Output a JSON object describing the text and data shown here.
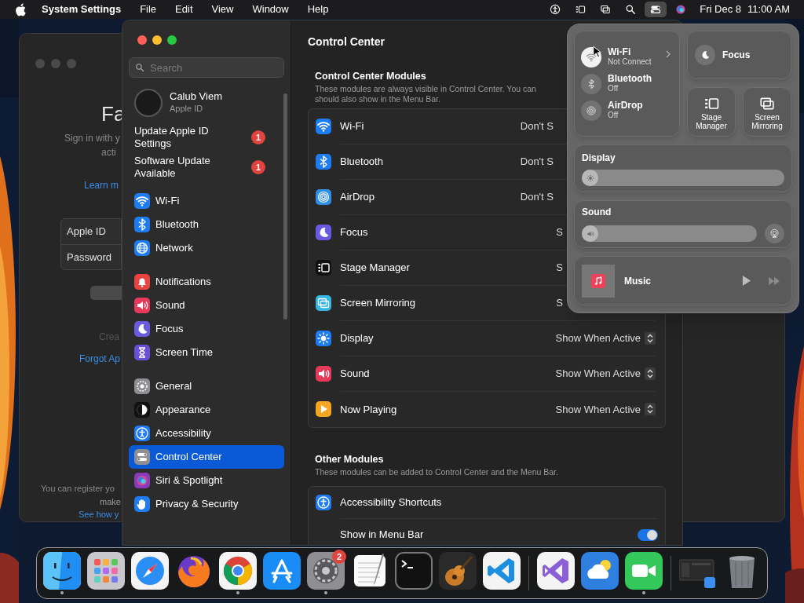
{
  "menu_bar": {
    "app_name": "System Settings",
    "menus": [
      "File",
      "Edit",
      "View",
      "Window",
      "Help"
    ],
    "status_icons": [
      {
        "kind": "accessibility",
        "selected": false
      },
      {
        "kind": "stage",
        "selected": false
      },
      {
        "kind": "mirroring",
        "selected": false
      },
      {
        "kind": "search",
        "selected": false
      },
      {
        "kind": "control",
        "selected": true
      },
      {
        "kind": "siri",
        "selected": false
      }
    ],
    "date": "Fri Dec 8",
    "time": "11:00 AM"
  },
  "background_window": {
    "title": "Fa",
    "subtitle_lines": [
      "Sign in with y",
      "acti"
    ],
    "link": "Learn m",
    "fields": [
      "Apple ID",
      "Password"
    ],
    "create_link": "Crea",
    "forgot_link": "Forgot Ap",
    "footer_lines": [
      "You can register yo",
      "make"
    ],
    "footer_link": "See how y"
  },
  "sidebar": {
    "search": {
      "placeholder": "Search"
    },
    "profile": {
      "name": "Calub Viem",
      "subtitle": "Apple ID"
    },
    "notices": [
      {
        "label": "Update Apple ID Settings",
        "badge": "1"
      },
      {
        "label": "Software Update Available",
        "badge": "1"
      }
    ],
    "groups": [
      [
        {
          "kind": "wifi",
          "color": "#1e7cf2",
          "label": "Wi-Fi",
          "selected": false
        },
        {
          "kind": "bluetooth",
          "color": "#1e7cf2",
          "label": "Bluetooth",
          "selected": false
        },
        {
          "kind": "globe",
          "color": "#1e7cf2",
          "label": "Network",
          "selected": false
        }
      ],
      [
        {
          "kind": "bell",
          "color": "#e9443f",
          "label": "Notifications",
          "selected": false
        },
        {
          "kind": "speaker",
          "color": "#e73a5b",
          "label": "Sound",
          "selected": false
        },
        {
          "kind": "moon",
          "color": "#6a5ae0",
          "label": "Focus",
          "selected": false
        },
        {
          "kind": "hourglass",
          "color": "#6a4fd8",
          "label": "Screen Time",
          "selected": false
        }
      ],
      [
        {
          "kind": "gear",
          "color": "#8e8e93",
          "label": "General",
          "selected": false
        },
        {
          "kind": "appearance",
          "color": "#111111",
          "label": "Appearance",
          "selected": false
        },
        {
          "kind": "person",
          "color": "#1e7cf2",
          "label": "Accessibility",
          "selected": false
        },
        {
          "kind": "toggles",
          "color": "#8e8e93",
          "label": "Control Center",
          "selected": true
        },
        {
          "kind": "orb",
          "color": "#8a3bb8",
          "label": "Siri & Spotlight",
          "selected": false
        },
        {
          "kind": "hand",
          "color": "#1e7cf2",
          "label": "Privacy & Security",
          "selected": false
        }
      ]
    ]
  },
  "content": {
    "title": "Control Center",
    "modules": {
      "title": "Control Center Modules",
      "description_lines": [
        "These modules are always visible in Control Center. You can",
        "should also show in the Menu Bar."
      ],
      "rows": [
        {
          "kind": "wifi",
          "color": "#1e7cf2",
          "label": "Wi-Fi",
          "value": "Don't S",
          "popup": false
        },
        {
          "kind": "bluetooth",
          "color": "#1e7cf2",
          "label": "Bluetooth",
          "value": "Don't S",
          "popup": false
        },
        {
          "kind": "rings",
          "color": "#2f8fe8",
          "label": "AirDrop",
          "value": "Don't S",
          "popup": false
        },
        {
          "kind": "moon",
          "color": "#6a5ae0",
          "label": "Focus",
          "value": "S",
          "popup": false
        },
        {
          "kind": "stage",
          "color": "#111111",
          "label": "Stage Manager",
          "value": "S",
          "popup": false
        },
        {
          "kind": "mirroring",
          "color": "#35b6e0",
          "label": "Screen Mirroring",
          "value": "S",
          "popup": false
        },
        {
          "kind": "sun",
          "color": "#1e7cf2",
          "label": "Display",
          "value": "Show When Active",
          "popup": true
        },
        {
          "kind": "speaker",
          "color": "#e73a5b",
          "label": "Sound",
          "value": "Show When Active",
          "popup": true
        },
        {
          "kind": "play",
          "color": "#f5a623",
          "label": "Now Playing",
          "value": "Show When Active",
          "popup": true
        }
      ]
    },
    "other": {
      "title": "Other Modules",
      "description": "These modules can be added to Control Center and the Menu Bar.",
      "rows": [
        {
          "kind": "accessibility",
          "color": "#1e7cf2",
          "label": "Accessibility Shortcuts"
        },
        {
          "kind": "toggle",
          "label": "Show in Menu Bar",
          "on": true
        }
      ]
    }
  },
  "control_center": {
    "connectivity": [
      {
        "kind": "wifi",
        "label": "Wi-Fi",
        "status": "Not Connect",
        "on": true,
        "expandable": true
      },
      {
        "kind": "bluetooth",
        "label": "Bluetooth",
        "status": "Off",
        "on": false,
        "expandable": false
      },
      {
        "kind": "rings",
        "label": "AirDrop",
        "status": "Off",
        "on": false,
        "expandable": false
      }
    ],
    "focus": {
      "label": "Focus"
    },
    "tiles": [
      {
        "kind": "stage",
        "label": "Stage Manager"
      },
      {
        "kind": "mirroring",
        "label": "Screen Mirroring"
      }
    ],
    "sliders": [
      {
        "kind": "sun",
        "label": "Display",
        "level": 0.04,
        "airplay": false
      },
      {
        "kind": "speaker",
        "label": "Sound",
        "level": 0.04,
        "airplay": true
      }
    ],
    "now_playing": {
      "app": "Music"
    }
  },
  "dock": {
    "sections": [
      [
        {
          "kind": "finder",
          "running": true
        },
        {
          "kind": "launchpad",
          "running": false
        },
        {
          "kind": "safari",
          "running": false
        },
        {
          "kind": "firefox",
          "running": false
        },
        {
          "kind": "chrome",
          "running": true
        },
        {
          "kind": "appstore",
          "running": false
        },
        {
          "kind": "settings",
          "running": true,
          "badge": "2"
        },
        {
          "kind": "textedit",
          "running": false
        },
        {
          "kind": "terminal",
          "running": false
        },
        {
          "kind": "guitar",
          "running": false
        },
        {
          "kind": "vscode",
          "running": false
        }
      ],
      [
        {
          "kind": "vstudio",
          "running": false
        },
        {
          "kind": "weather",
          "running": false
        },
        {
          "kind": "facetime",
          "running": true
        }
      ],
      [
        {
          "kind": "thumbnail",
          "running": false
        },
        {
          "kind": "trash",
          "running": false
        }
      ]
    ]
  }
}
